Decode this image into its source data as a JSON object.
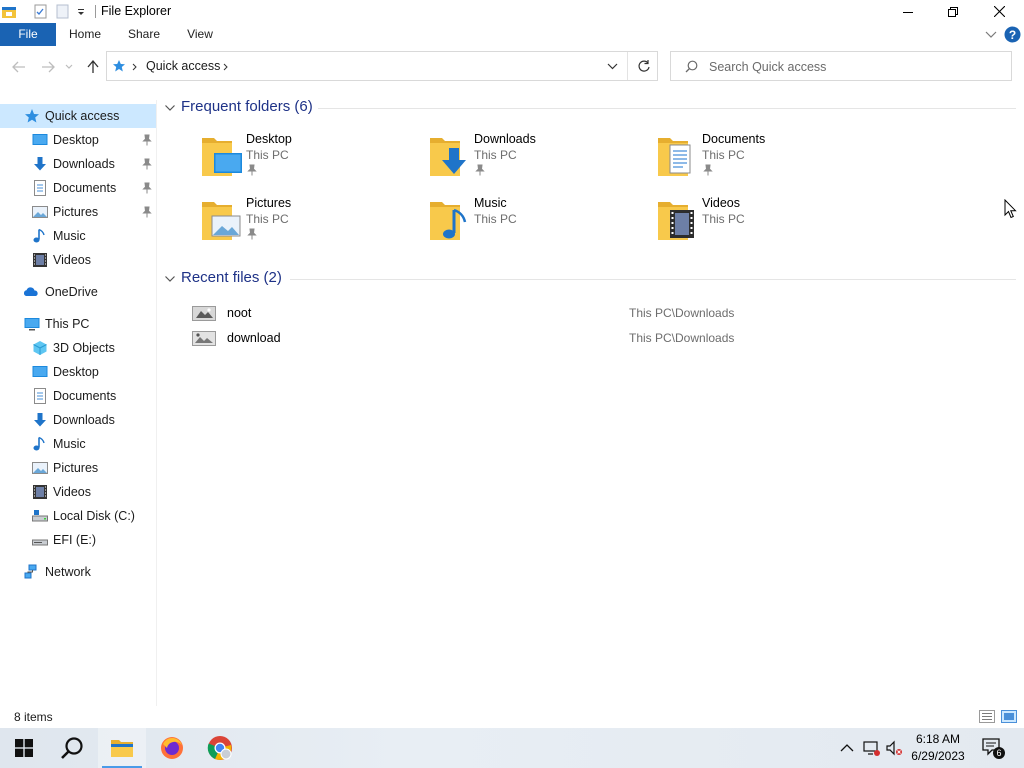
{
  "window": {
    "title": "File Explorer",
    "controls": {
      "minimize": "minimize",
      "maximize": "restore",
      "close": "close"
    }
  },
  "ribbon": {
    "tabs": [
      {
        "label": "File"
      },
      {
        "label": "Home"
      },
      {
        "label": "Share"
      },
      {
        "label": "View"
      }
    ]
  },
  "address": {
    "crumb": "Quick access",
    "search_placeholder": "Search Quick access"
  },
  "nav": {
    "quick_access": "Quick access",
    "qa_items": [
      {
        "label": "Desktop",
        "icon": "desktop-icon",
        "pinned": true
      },
      {
        "label": "Downloads",
        "icon": "downloads-icon",
        "pinned": true
      },
      {
        "label": "Documents",
        "icon": "documents-icon",
        "pinned": true
      },
      {
        "label": "Pictures",
        "icon": "pictures-icon",
        "pinned": true
      },
      {
        "label": "Music",
        "icon": "music-icon",
        "pinned": false
      },
      {
        "label": "Videos",
        "icon": "videos-icon",
        "pinned": false
      }
    ],
    "onedrive": "OneDrive",
    "this_pc": "This PC",
    "pc_items": [
      {
        "label": "3D Objects",
        "icon": "3d-objects-icon"
      },
      {
        "label": "Desktop",
        "icon": "desktop-icon"
      },
      {
        "label": "Documents",
        "icon": "documents-icon"
      },
      {
        "label": "Downloads",
        "icon": "downloads-icon"
      },
      {
        "label": "Music",
        "icon": "music-icon"
      },
      {
        "label": "Pictures",
        "icon": "pictures-icon"
      },
      {
        "label": "Videos",
        "icon": "videos-icon"
      },
      {
        "label": "Local Disk (C:)",
        "icon": "local-disk-icon"
      },
      {
        "label": "EFI (E:)",
        "icon": "drive-icon"
      }
    ],
    "network": "Network"
  },
  "frequent": {
    "title": "Frequent folders (6)",
    "folders": [
      {
        "name": "Desktop",
        "location": "This PC",
        "pinned": true
      },
      {
        "name": "Downloads",
        "location": "This PC",
        "pinned": true
      },
      {
        "name": "Documents",
        "location": "This PC",
        "pinned": true
      },
      {
        "name": "Pictures",
        "location": "This PC",
        "pinned": true
      },
      {
        "name": "Music",
        "location": "This PC",
        "pinned": false
      },
      {
        "name": "Videos",
        "location": "This PC",
        "pinned": false
      }
    ]
  },
  "recent": {
    "title": "Recent files (2)",
    "files": [
      {
        "name": "noot",
        "path": "This PC\\Downloads"
      },
      {
        "name": "download",
        "path": "This PC\\Downloads"
      }
    ]
  },
  "status": {
    "items": "8 items"
  },
  "taskbar": {
    "time": "6:18 AM",
    "date": "6/29/2023",
    "notifications": "6"
  },
  "colors": {
    "accent": "#1a63b3",
    "selection": "#cce8ff",
    "group_header": "#1e3287",
    "folder_yellow": "#f8c94b"
  }
}
